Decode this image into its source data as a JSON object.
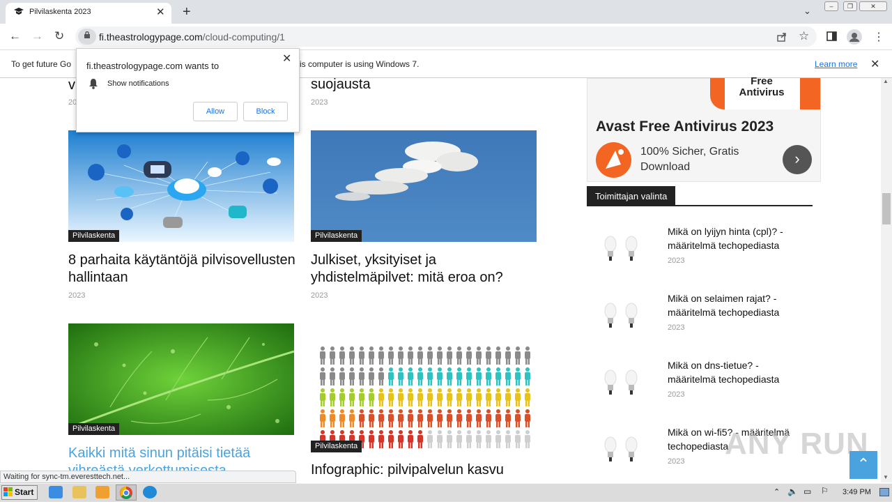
{
  "browser": {
    "tab_title": "Pilvilaskenta 2023",
    "url_host": "fi.theastrologypage.com",
    "url_path": "/cloud-computing/1",
    "info_bar": {
      "text_left": "To get future Go",
      "text_right": "is computer is using Windows 7.",
      "learn_more": "Learn more"
    },
    "status_text": "Waiting for sync-tm.everesttech.net..."
  },
  "notification": {
    "title": "fi.theastrologypage.com wants to",
    "permission": "Show notifications",
    "allow": "Allow",
    "block": "Block"
  },
  "articles": {
    "top_left_title_fragment": "v",
    "top_left_year": "20",
    "top_right_title_fragment": "suojausta",
    "top_right_year": "2023",
    "items": [
      {
        "category": "Pilvilaskenta",
        "title": "8 parhaita käytäntöjä pilvisovellusten hallintaan",
        "year": "2023"
      },
      {
        "category": "Pilvilaskenta",
        "title": "Julkiset, yksityiset ja yhdistelmäpilvet: mitä eroa on?",
        "year": "2023"
      },
      {
        "category": "Pilvilaskenta",
        "title": "Kaikki mitä sinun pitäisi tietää vihreästä verkottumisesta",
        "year": ""
      },
      {
        "category": "Pilvilaskenta",
        "title": "Infographic: pilvipalvelun kasvu",
        "year": ""
      }
    ]
  },
  "ad": {
    "box_text": "Free Antivirus",
    "title": "Avast Free Antivirus 2023",
    "subtitle": "100% Sicher, Gratis Download"
  },
  "sidebar": {
    "section_label": "Toimittajan valinta",
    "items": [
      {
        "title": "Mikä on lyijyn hinta (cpl)? - määritelmä techopediasta",
        "year": "2023"
      },
      {
        "title": "Mikä on selaimen rajat? - määritelmä techopediasta",
        "year": "2023"
      },
      {
        "title": "Mikä on dns-tietue? - määritelmä techopediasta",
        "year": "2023"
      },
      {
        "title": "Mikä on wi-fi5? - määritelmä techopediasta",
        "year": "2023"
      }
    ]
  },
  "watermark": "ANY RUN",
  "taskbar": {
    "start": "Start",
    "clock": "3:49 PM"
  },
  "colors": {
    "accent": "#1a73e8",
    "link_article": "#4aa3df",
    "ad_orange": "#f26522"
  }
}
